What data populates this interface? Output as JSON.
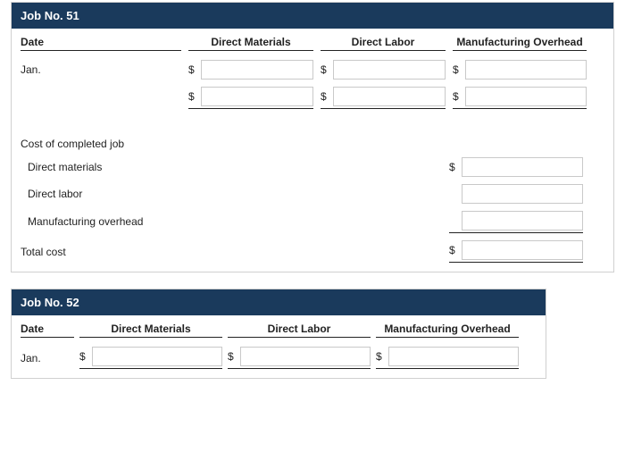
{
  "currency": "$",
  "job51": {
    "title": "Job No. 51",
    "headers": {
      "date": "Date",
      "dm": "Direct Materials",
      "dl": "Direct Labor",
      "moh": "Manufacturing Overhead"
    },
    "date_label": "Jan.",
    "row1": {
      "dm": "",
      "dl": "",
      "moh": ""
    },
    "row2": {
      "dm": "",
      "dl": "",
      "moh": ""
    },
    "completed": {
      "heading": "Cost of completed job",
      "dm_label": "Direct materials",
      "dl_label": "Direct labor",
      "moh_label": "Manufacturing overhead",
      "total_label": "Total cost",
      "dm_value": "",
      "dl_value": "",
      "moh_value": "",
      "total_value": ""
    }
  },
  "job52": {
    "title": "Job No. 52",
    "headers": {
      "date": "Date",
      "dm": "Direct Materials",
      "dl": "Direct Labor",
      "moh": "Manufacturing Overhead"
    },
    "date_label": "Jan.",
    "row1": {
      "dm": "",
      "dl": "",
      "moh": ""
    }
  }
}
